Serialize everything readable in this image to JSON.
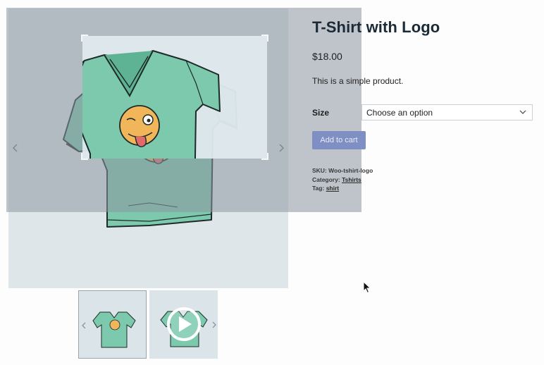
{
  "product": {
    "title": "T-Shirt with Logo",
    "price": "$18.00",
    "description": "This is a simple product."
  },
  "variation": {
    "label": "Size",
    "selected": "Choose an option"
  },
  "add_to_cart_label": "Add to cart",
  "meta": {
    "sku_label": "SKU:",
    "sku_value": "Woo-tshirt-logo",
    "category_label": "Category:",
    "category_value": "Tshirts",
    "tag_label": "Tag:",
    "tag_value": "shirt"
  },
  "gallery": {
    "thumbnails": [
      {
        "name": "t-shirt image",
        "icon": "tshirt-thumbnail"
      },
      {
        "name": "video",
        "icon": "play-icon"
      }
    ]
  },
  "colors": {
    "accent_button": "#7f8fc3",
    "shirt": "#7cc9ae",
    "logo_face": "#f2b65a"
  }
}
